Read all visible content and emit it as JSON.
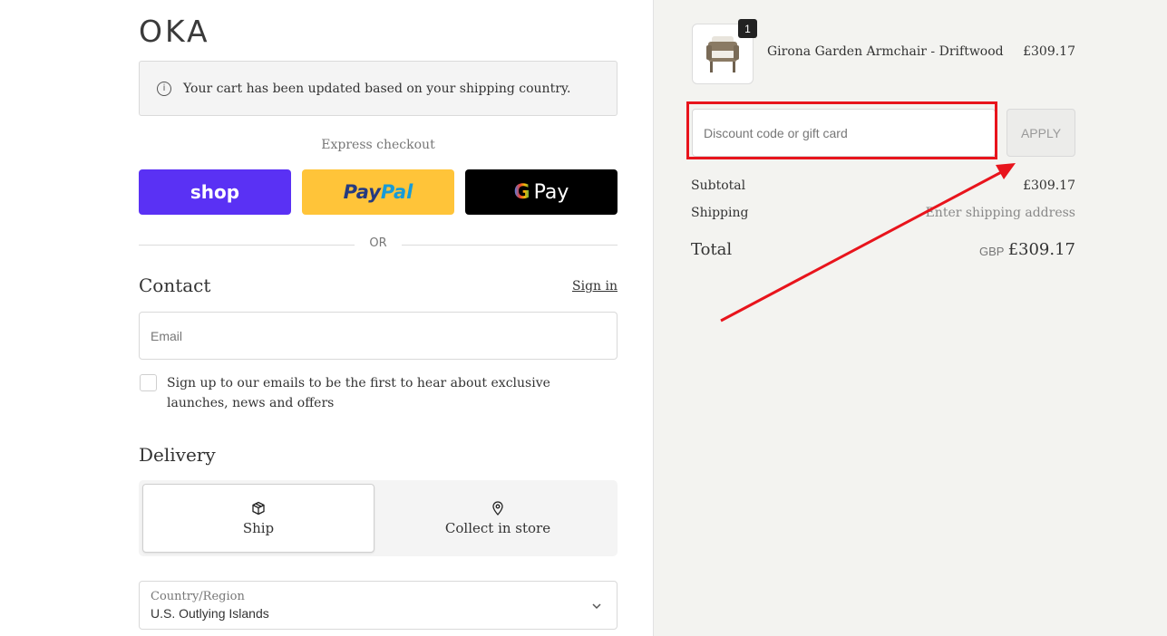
{
  "brand": {
    "logo": "OKA"
  },
  "notice": {
    "icon": "info-icon",
    "text": "Your cart has been updated based on your shipping country."
  },
  "express": {
    "label": "Express checkout",
    "shop_label": "shop",
    "paypal_part1": "Pay",
    "paypal_part2": "Pal",
    "gpay_g": "G",
    "gpay_label": "Pay",
    "or_label": "OR"
  },
  "contact": {
    "heading": "Contact",
    "signin_label": "Sign in",
    "email_placeholder": "Email",
    "newsletter_label": "Sign up to our emails to be the first to hear about exclusive launches, news and offers",
    "newsletter_checked": false
  },
  "delivery": {
    "heading": "Delivery",
    "options": [
      {
        "label": "Ship",
        "icon": "box-icon",
        "selected": true
      },
      {
        "label": "Collect in store",
        "icon": "location-pin-icon",
        "selected": false
      }
    ],
    "country_label": "Country/Region",
    "country_value": "U.S. Outlying Islands"
  },
  "summary": {
    "item": {
      "name": "Girona Garden Armchair - Driftwood",
      "price": "£309.17",
      "quantity": "1"
    },
    "discount_placeholder": "Discount code or gift card",
    "apply_label": "APPLY",
    "subtotal_label": "Subtotal",
    "subtotal_value": "£309.17",
    "shipping_label": "Shipping",
    "shipping_value": "Enter shipping address",
    "total_label": "Total",
    "currency": "GBP",
    "total_value": "£309.17"
  },
  "colors": {
    "shop": "#5a31f4",
    "paypal": "#ffc439",
    "gpay": "#000000",
    "annotation": "#e8141c",
    "summary_bg": "#f3f3f0"
  }
}
